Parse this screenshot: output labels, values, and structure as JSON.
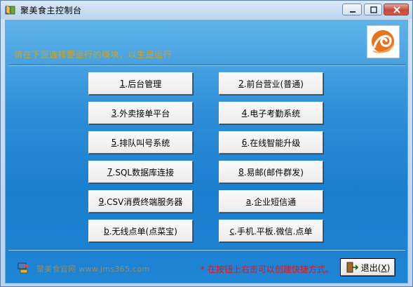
{
  "window": {
    "title": "聚美食主控制台"
  },
  "hint": "请在下面选择要运行的模块，以生是运行",
  "menu": {
    "left": [
      {
        "key": "1",
        "label": ".后台管理"
      },
      {
        "key": "3",
        "label": ".外卖接单平台"
      },
      {
        "key": "5",
        "label": ".排队叫号系统"
      },
      {
        "key": "7",
        "label": ".SQL数据库连接"
      },
      {
        "key": "9",
        "label": ".CSV消费终端服务器"
      },
      {
        "key": "b",
        "label": ".无线点单(点菜宝)"
      }
    ],
    "right": [
      {
        "key": "2",
        "label": ".前台营业(普通)"
      },
      {
        "key": "4",
        "label": ".电子考勤系统"
      },
      {
        "key": "6",
        "label": ".在线智能升级"
      },
      {
        "key": "8",
        "label": ".易邮(邮件群发)"
      },
      {
        "key": "a",
        "label": ".企业短信通"
      },
      {
        "key": "c",
        "label": ".手机.平板.微信.点单"
      }
    ]
  },
  "footer": {
    "site": "聚美食官网 www.jms365.com",
    "tip": "* 在按钮上右击可以创建快捷方式。",
    "exit_label": "退出",
    "exit_key": "X"
  },
  "colors": {
    "hint": "#d2a31a",
    "tip": "#e21616",
    "logo_orange": "#e8731f"
  }
}
